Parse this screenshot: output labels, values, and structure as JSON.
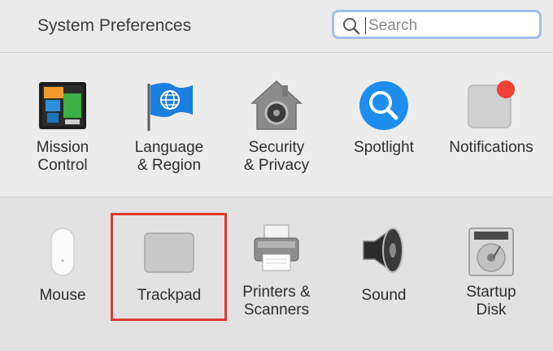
{
  "window": {
    "title": "System Preferences"
  },
  "search": {
    "placeholder": "Search",
    "value": ""
  },
  "colors": {
    "highlight": "#e03a2f",
    "search_focus": "#9ebfe8",
    "badge": "#f0433a"
  },
  "row1": [
    {
      "label": "Mission\nControl",
      "icon": "mission-control-icon"
    },
    {
      "label": "Language\n& Region",
      "icon": "language-region-icon"
    },
    {
      "label": "Security\n& Privacy",
      "icon": "security-privacy-icon"
    },
    {
      "label": "Spotlight",
      "icon": "spotlight-icon"
    },
    {
      "label": "Notifications",
      "icon": "notifications-icon"
    }
  ],
  "row2": [
    {
      "label": "Mouse",
      "icon": "mouse-icon"
    },
    {
      "label": "Trackpad",
      "icon": "trackpad-icon",
      "highlighted": true
    },
    {
      "label": "Printers &\nScanners",
      "icon": "printers-scanners-icon"
    },
    {
      "label": "Sound",
      "icon": "sound-icon"
    },
    {
      "label": "Startup\nDisk",
      "icon": "startup-disk-icon"
    }
  ]
}
